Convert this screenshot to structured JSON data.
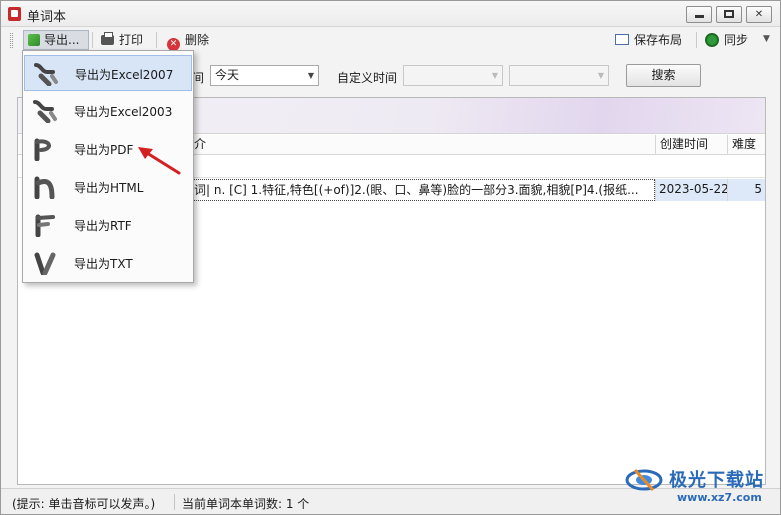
{
  "window": {
    "title": "单词本"
  },
  "toolbar": {
    "export_label": "导出...",
    "print_label": "打印",
    "delete_label": "删除",
    "save_layout_label": "保存布局",
    "sync_label": "同步"
  },
  "filters": {
    "time_label_partial": "间",
    "time_value": "今天",
    "custom_time_label": "自定义时间",
    "search_button": "搜索"
  },
  "export_menu": {
    "items": [
      {
        "label": "导出为Excel2007",
        "icon": "excel2007-icon"
      },
      {
        "label": "导出为Excel2003",
        "icon": "excel2003-icon"
      },
      {
        "label": "导出为PDF",
        "icon": "pdf-icon"
      },
      {
        "label": "导出为HTML",
        "icon": "html-icon"
      },
      {
        "label": "导出为RTF",
        "icon": "rtf-icon"
      },
      {
        "label": "导出为TXT",
        "icon": "txt-icon"
      }
    ]
  },
  "grid": {
    "columns": [
      "简介",
      "创建时间",
      "难度"
    ],
    "rows": [
      {
        "brief": "名词| n. [C]  1.特征,特色[(+of)]2.(眼、口、鼻等)脸的一部分3.面貌,相貌[P]4.(报纸...",
        "created": "2023-05-22",
        "difficulty": "5"
      }
    ]
  },
  "status": {
    "hint": "(提示: 单击音标可以发声。)",
    "count_text": "当前单词本单词数: 1 个"
  },
  "watermark": {
    "brand": "极光下载站",
    "url": "www.xz7.com"
  },
  "colors": {
    "accent_blue": "#2a6ab8",
    "selection": "#d7e5f7",
    "annotation_red": "#d42020"
  }
}
